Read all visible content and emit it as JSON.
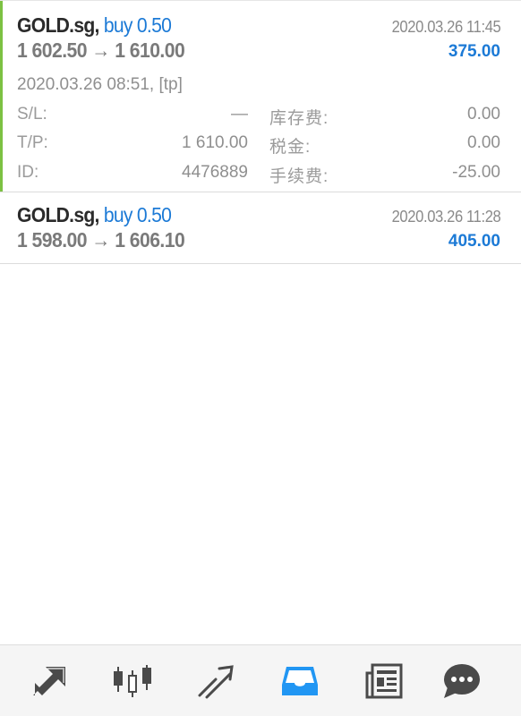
{
  "trades": [
    {
      "symbol": "GOLD.sg,",
      "direction": "buy 0.50",
      "prices": "1 602.50 → 1 610.00",
      "close_time": "2020.03.26 11:45",
      "profit": "375.00",
      "open_line": "2020.03.26 08:51, [tp]",
      "details": {
        "sl_label": "S/L:",
        "sl_value": "—",
        "tp_label": "T/P:",
        "tp_value": "1 610.00",
        "id_label": "ID:",
        "id_value": "4476889",
        "swap_label": "库存费:",
        "swap_value": "0.00",
        "tax_label": "税金:",
        "tax_value": "0.00",
        "commission_label": "手续费:",
        "commission_value": "-25.00"
      }
    },
    {
      "symbol": "GOLD.sg,",
      "direction": "buy 0.50",
      "prices": "1 598.00 → 1 606.10",
      "close_time": "2020.03.26 11:28",
      "profit": "405.00"
    }
  ],
  "toolbar": {
    "items": [
      {
        "icon": "quotes-icon"
      },
      {
        "icon": "chart-icon"
      },
      {
        "icon": "trade-icon"
      },
      {
        "icon": "history-icon",
        "active": true
      },
      {
        "icon": "news-icon"
      },
      {
        "icon": "messages-icon"
      }
    ]
  },
  "colors": {
    "accent_blue": "#1c7ad6",
    "profit_bar_green": "#7cc142",
    "icon_gray": "#4a4a4a"
  }
}
